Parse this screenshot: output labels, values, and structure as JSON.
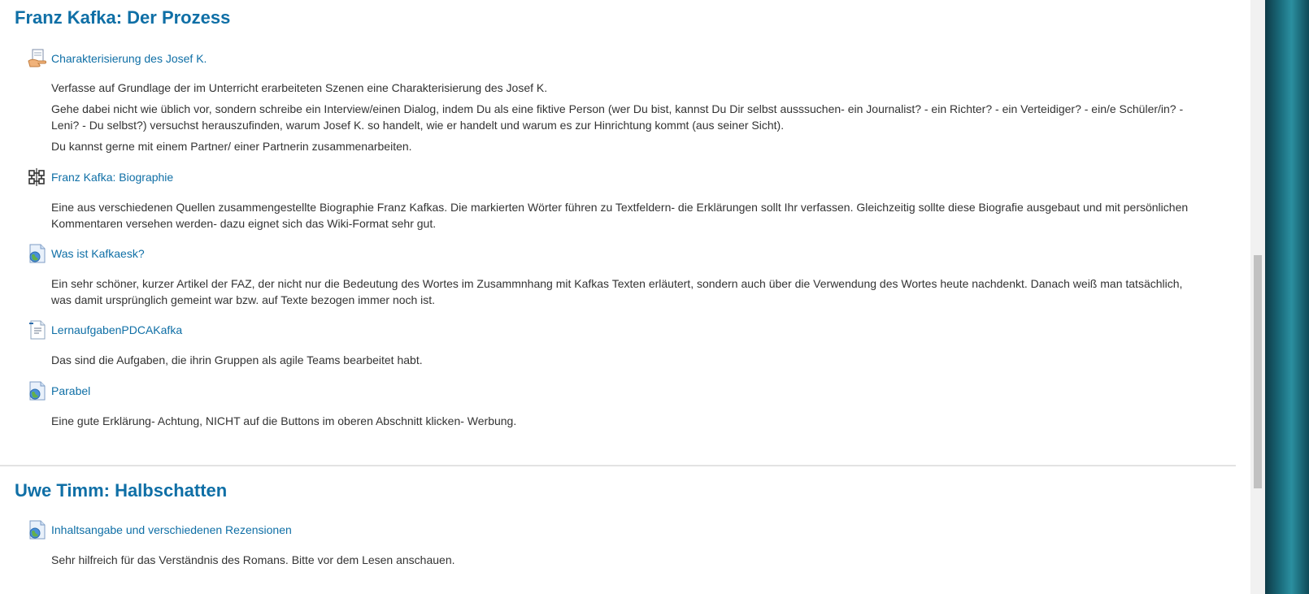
{
  "sections": [
    {
      "title": "Franz Kafka: Der Prozess",
      "activities": [
        {
          "icon": "hand-document-icon",
          "link": "Charakterisierung des Josef K.",
          "paragraphs": [
            "Verfasse auf Grundlage der im Unterricht erarbeiteten Szenen  eine Charakterisierung des Josef K.",
            "Gehe dabei nicht wie üblich vor, sondern schreibe ein Interview/einen Dialog, indem Du als eine fiktive Person (wer Du bist, kannst Du Dir selbst ausssuchen- ein Journalist? - ein Richter? - ein Verteidiger? - ein/e Schüler/in? - Leni? - Du selbst?) versuchst herauszufinden, warum Josef K. so handelt, wie er handelt und warum es zur Hinrichtung kommt (aus seiner Sicht).",
            "Du kannst gerne mit einem Partner/ einer Partnerin zusammenarbeiten."
          ]
        },
        {
          "icon": "wiki-icon",
          "link": "Franz Kafka: Biographie",
          "paragraphs": [
            "Eine aus verschiedenen Quellen zusammengestellte Biographie Franz Kafkas. Die markierten Wörter führen zu Textfeldern- die Erklärungen sollt Ihr verfassen. Gleichzeitig sollte diese Biografie ausgebaut und mit persönlichen Kommentaren versehen werden- dazu eignet sich das Wiki-Format sehr gut."
          ]
        },
        {
          "icon": "url-globe-icon",
          "link": "Was ist Kafkaesk?",
          "paragraphs": [
            "Ein sehr schöner, kurzer Artikel der FAZ, der nicht nur die Bedeutung des Wortes im Zusammnhang mit Kafkas Texten erläutert, sondern auch über die Verwendung des Wortes heute nachdenkt. Danach weiß man tatsächlich, was damit ursprünglich gemeint war bzw. auf Texte bezogen immer noch ist."
          ]
        },
        {
          "icon": "file-document-icon",
          "link": "LernaufgabenPDCAKafka",
          "paragraphs": [
            "Das sind die Aufgaben, die ihrin Gruppen als agile Teams bearbeitet habt."
          ]
        },
        {
          "icon": "url-globe-icon",
          "link": "Parabel",
          "paragraphs": [
            "Eine gute Erklärung- Achtung, NICHT auf die Buttons im oberen Abschnitt klicken- Werbung."
          ]
        }
      ]
    },
    {
      "title": "Uwe Timm: Halbschatten",
      "activities": [
        {
          "icon": "url-globe-icon",
          "link": "Inhaltsangabe und verschiedenen Rezensionen",
          "paragraphs": [
            "Sehr hilfreich für das Verständnis des Romans. Bitte vor dem Lesen anschauen."
          ]
        }
      ]
    }
  ],
  "colors": {
    "link": "#0f6fa6",
    "text": "#333333",
    "divider": "#e3e3e3"
  }
}
